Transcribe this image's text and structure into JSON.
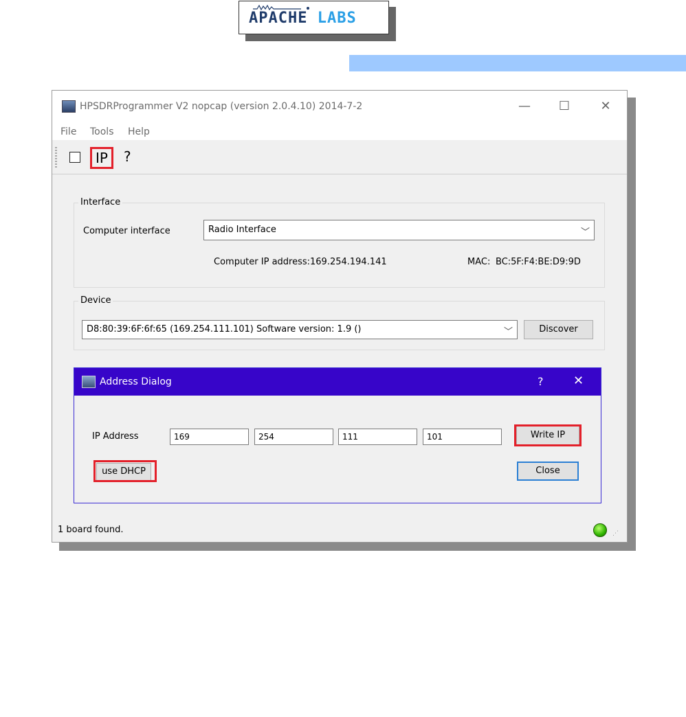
{
  "logo": {
    "brand": "APACHE",
    "suffix": "LABS"
  },
  "window": {
    "title": "HPSDRProgrammer V2 nopcap (version 2.0.4.10) 2014-7-2",
    "controls": {
      "minimize": "—",
      "maximize": "☐",
      "close": "✕"
    }
  },
  "menu": {
    "file": "File",
    "tools": "Tools",
    "help": "Help"
  },
  "toolbar": {
    "ip": "IP",
    "help": "?"
  },
  "interface": {
    "group_label": "Interface",
    "computer_interface_label": "Computer interface",
    "computer_interface_value": "Radio Interface",
    "ip_label": "Computer IP address:",
    "ip_value": "169.254.194.141",
    "mac_label": "MAC:",
    "mac_value": "BC:5F:F4:BE:D9:9D"
  },
  "device": {
    "group_label": "Device",
    "selected": "D8:80:39:6F:6f:65 (169.254.111.101) Software version: 1.9 ()",
    "discover": "Discover"
  },
  "dialog": {
    "title": "Address Dialog",
    "help": "?",
    "close_x": "✕",
    "ip_label": "IP Address",
    "octets": [
      "169",
      "254",
      "111",
      "101"
    ],
    "write_ip": "Write IP",
    "use_dhcp": "use DHCP",
    "close": "Close"
  },
  "status": {
    "text": "1 board found."
  },
  "colors": {
    "dialog_title": "#3705c9",
    "highlight": "#e3202a",
    "header_bar": "#9ec9ff",
    "led": "#2fb400"
  }
}
